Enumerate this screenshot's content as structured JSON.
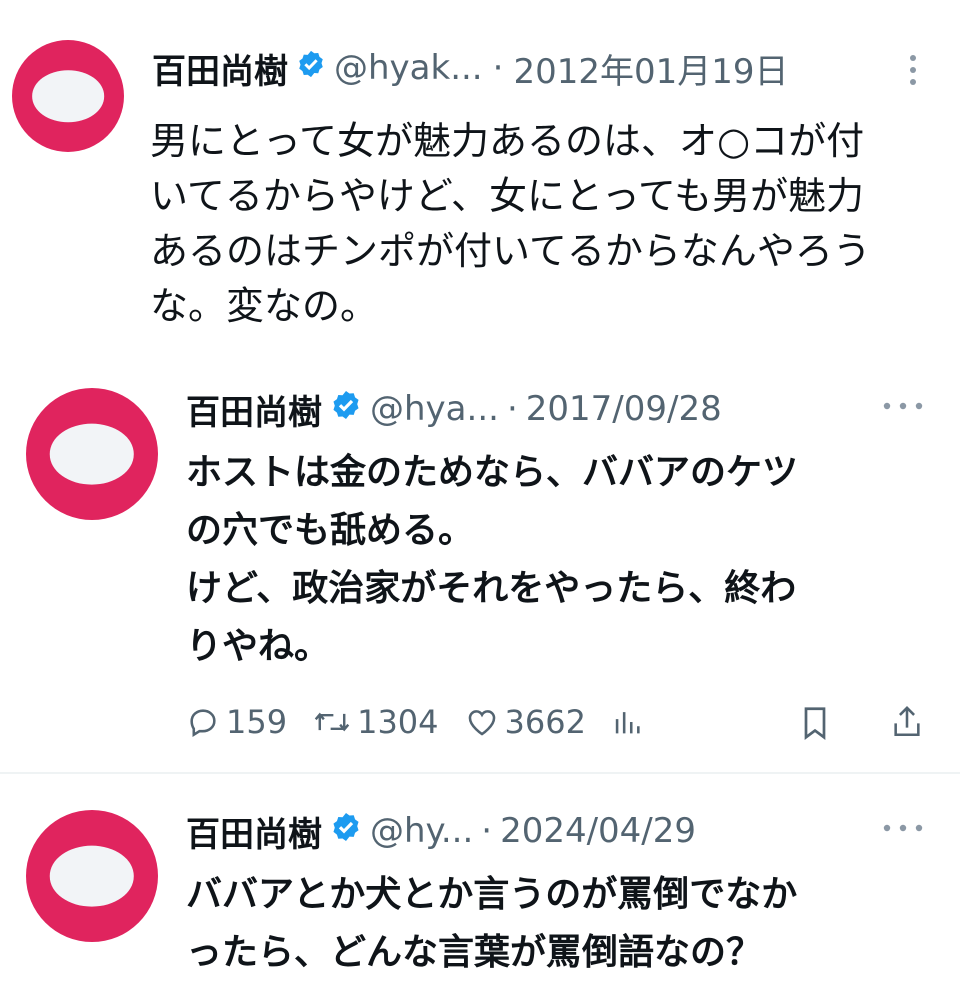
{
  "tweets": [
    {
      "name": "百田尚樹",
      "handle": "@hyak...",
      "separator": "·",
      "date": "2012年01月19日",
      "text": "男にとって女が魅力あるのは、オ○コが付\nいてるからやけど、女にとっても男が魅力\nあるのはチンポが付いてるからなんやろう\nな。変なの。",
      "more_icon": "more-vertical-icon"
    },
    {
      "name": "百田尚樹",
      "handle": "@hya...",
      "separator": "·",
      "date": "2017/09/28",
      "text": "ホストは金のためなら、ババアのケツ\nの穴でも舐める。\nけど、政治家がそれをやったら、終わ\nりやね。",
      "more_icon": "more-horizontal-icon",
      "actions": {
        "replies": "159",
        "retweets": "1304",
        "likes": "3662"
      }
    },
    {
      "name": "百田尚樹",
      "handle": "@hy...",
      "separator": "·",
      "date": "2024/04/29",
      "text": "ババアとか犬とか言うのが罵倒でなか\nったら、どんな言葉が罵倒語なの？",
      "more_icon": "more-horizontal-icon"
    }
  ],
  "colors": {
    "avatar": "#e0245e",
    "verified": "#1d9bf0",
    "secondary_text": "#536471",
    "primary_text": "#0f1419"
  }
}
